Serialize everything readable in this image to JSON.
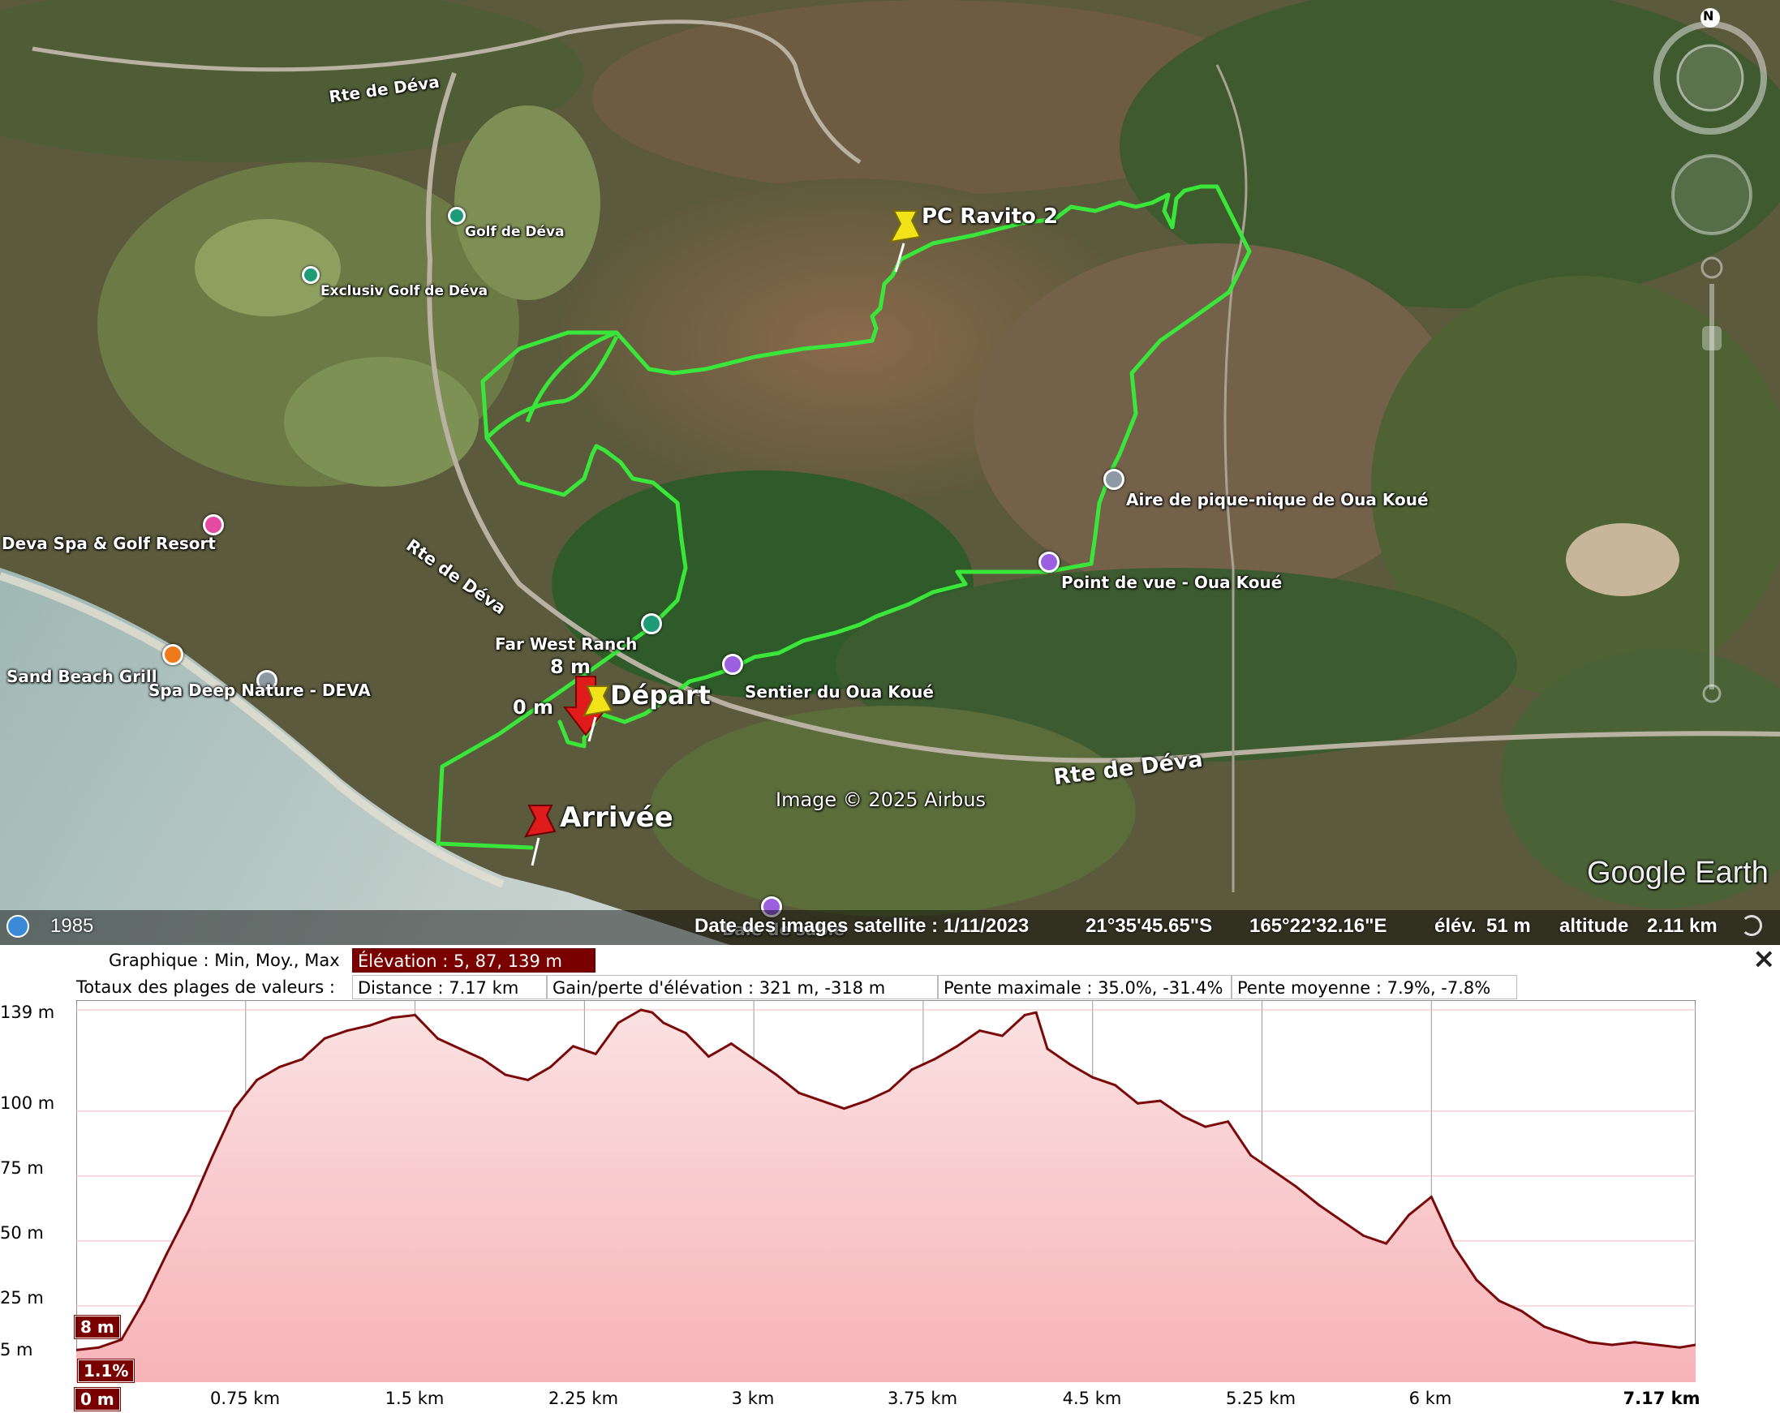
{
  "map": {
    "roads": {
      "road_top": "Rte de Déva",
      "road_left": "Rte de Déva",
      "road_main": "Rte de Déva"
    },
    "placemarks": {
      "ravito": "PC Ravito 2",
      "depart": "Départ",
      "arrivee": "Arrivée",
      "start_elev": "8 m",
      "start_dist": "0 m"
    },
    "pois": {
      "golf_deva": "Golf de Déva",
      "exclusiv_golf": "Exclusiv Golf de Déva",
      "deva_spa": "Deva Spa & Golf Resort",
      "sand_beach": "Sand Beach Grill",
      "spa_deep": "Spa Deep Nature - DEVA",
      "far_west": "Far West Ranch",
      "sentier": "Sentier du Oua Koué",
      "aire": "Aire de pique-nique de Oua Koué",
      "point_vue": "Point de vue - Oua Koué",
      "partial_poi": "Baie de sable"
    },
    "attribution": "Image © 2025 Airbus",
    "logo": "Google Earth",
    "compass_letter": "N",
    "status_bar": {
      "history_year": "1985",
      "imagery_date": "Date des images satellite : 1/11/2023",
      "latitude": "21°35'45.65\"S",
      "longitude": "165°22'32.16\"E",
      "elevation_label": "élév.",
      "elevation_value": "51 m",
      "altitude_label": "altitude",
      "altitude_value": "2.11 km"
    },
    "colors": {
      "track": "#39e639",
      "pin_yellow": "#f2e21a",
      "pin_red": "#e01b1b"
    }
  },
  "profile": {
    "header": {
      "graph_label": "Graphique : Min, Moy., Max",
      "elevation_box": "Élévation : 5, 87, 139 m",
      "totals_label": "Totaux des plages de valeurs :",
      "distance_box": "Distance : 7.17 km",
      "gain_box": "Gain/perte d'élévation : 321 m, -318 m",
      "slope_max_box": "Pente maximale : 35.0%, -31.4%",
      "slope_avg_box": "Pente moyenne : 7.9%, -7.8%",
      "close_icon": "×"
    },
    "y_ticks": [
      "139 m",
      "100 m",
      "75 m",
      "50 m",
      "25 m",
      "5 m"
    ],
    "x_ticks": [
      "0.75 km",
      "1.5 km",
      "2.25 km",
      "3 km",
      "3.75 km",
      "4.5 km",
      "5.25 km",
      "6 km",
      "7.17 km"
    ],
    "cursor": {
      "elevation": "8 m",
      "slope": "1.1%",
      "distance": "0 m"
    },
    "colors": {
      "line": "#7a0a0a",
      "fill_top": "#fbe1e1",
      "fill_bottom": "#f7b3b8",
      "tag": "#7a0000"
    }
  },
  "chart_data": {
    "type": "area",
    "title": "",
    "xlabel": "",
    "ylabel": "",
    "x_unit": "km",
    "y_unit": "m",
    "xlim": [
      0,
      7.17
    ],
    "ylim": [
      5,
      139
    ],
    "grid": true,
    "x": [
      0,
      0.1,
      0.2,
      0.3,
      0.4,
      0.5,
      0.6,
      0.7,
      0.8,
      0.9,
      1.0,
      1.1,
      1.2,
      1.3,
      1.4,
      1.5,
      1.6,
      1.7,
      1.8,
      1.9,
      2.0,
      2.1,
      2.2,
      2.3,
      2.4,
      2.5,
      2.55,
      2.6,
      2.7,
      2.8,
      2.9,
      3.0,
      3.1,
      3.2,
      3.3,
      3.4,
      3.5,
      3.6,
      3.7,
      3.8,
      3.9,
      4.0,
      4.1,
      4.2,
      4.25,
      4.3,
      4.4,
      4.5,
      4.6,
      4.7,
      4.8,
      4.9,
      5.0,
      5.1,
      5.2,
      5.3,
      5.4,
      5.5,
      5.6,
      5.7,
      5.8,
      5.9,
      6.0,
      6.1,
      6.2,
      6.3,
      6.4,
      6.5,
      6.6,
      6.7,
      6.8,
      6.9,
      7.0,
      7.1,
      7.17
    ],
    "series": [
      {
        "values": [
          8,
          9,
          12,
          27,
          45,
          62,
          82,
          101,
          112,
          117,
          120,
          128,
          131,
          133,
          136,
          137,
          128,
          124,
          120,
          114,
          112,
          117,
          125,
          122,
          134,
          139,
          138,
          134,
          130,
          121,
          126,
          120,
          114,
          107,
          104,
          101,
          104,
          108,
          116,
          120,
          125,
          131,
          129,
          137,
          138,
          124,
          118,
          113,
          110,
          103,
          104,
          98,
          94,
          96,
          83,
          77,
          71,
          64,
          58,
          52,
          49,
          60,
          67,
          48,
          35,
          27,
          23,
          17,
          14,
          11,
          10,
          11,
          10,
          9,
          10
        ]
      }
    ]
  }
}
